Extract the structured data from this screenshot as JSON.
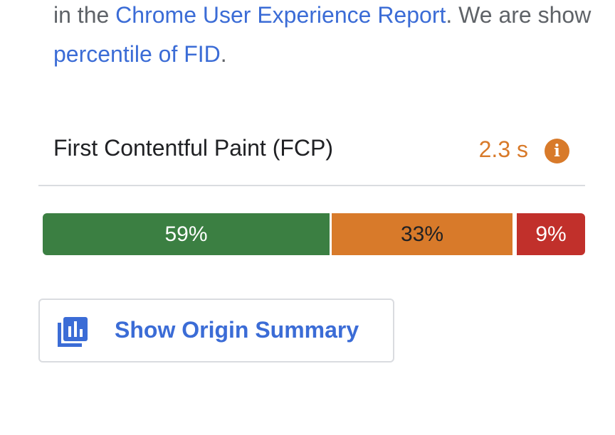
{
  "intro": {
    "line1_prefix": "in the ",
    "line1_link": "Chrome User Experience Report",
    "line1_suffix": ". We are show",
    "line2_link": "percentile of FID",
    "line2_suffix": "."
  },
  "metric": {
    "name": "First Contentful Paint (FCP)",
    "value": "2.3 s",
    "value_color": "#d87a2a",
    "info_icon": "info-icon",
    "info_glyph": "i"
  },
  "distribution": {
    "good": {
      "label": "59%",
      "value": 59,
      "color": "#3b7f42"
    },
    "needs_improvement": {
      "label": "33%",
      "value": 33,
      "color": "#d87a2a"
    },
    "poor": {
      "label": "9%",
      "value": 9,
      "color": "#c1302b"
    }
  },
  "origin_button": {
    "label": "Show Origin Summary",
    "icon": "bar-chart-stack-icon",
    "color": "#3b6cd6"
  }
}
